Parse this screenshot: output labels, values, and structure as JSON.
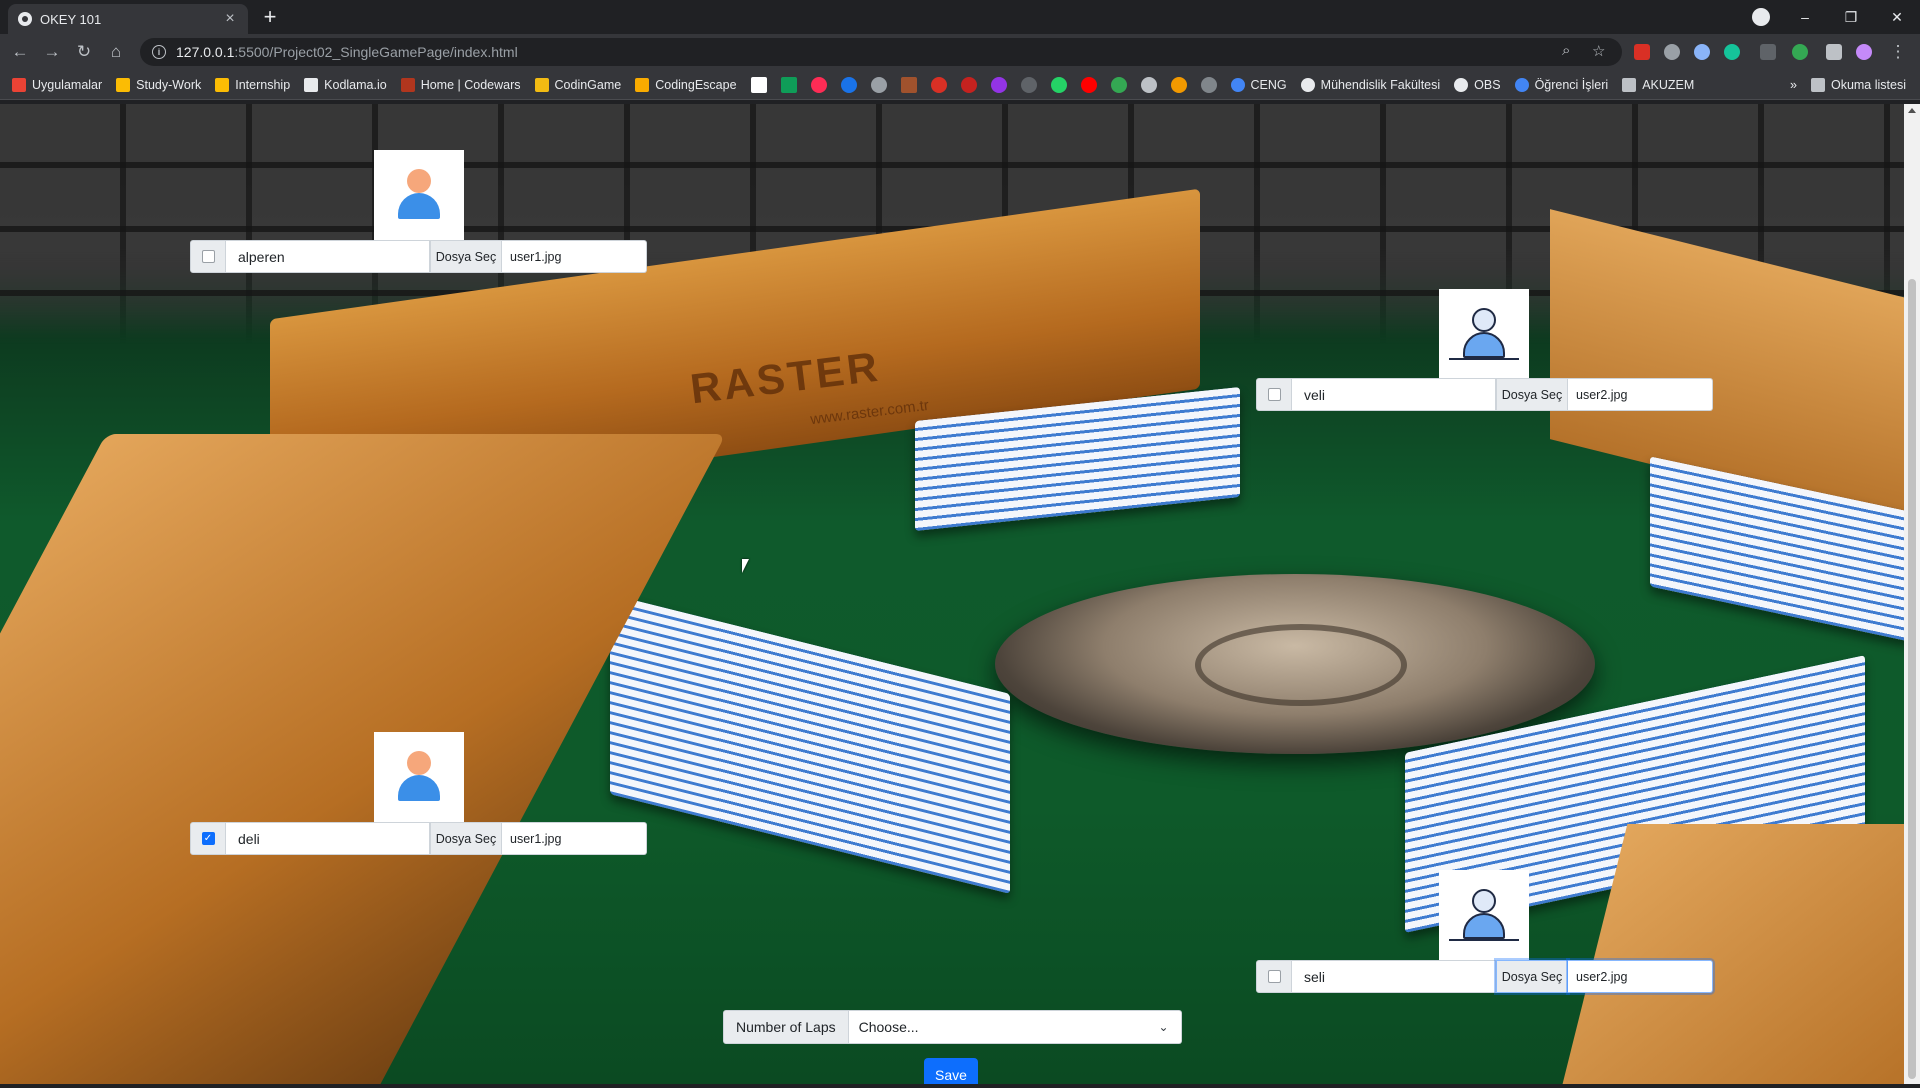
{
  "browser": {
    "tab_title": "OKEY 101",
    "url_host": "127.0.0.1",
    "url_path": ":5500/Project02_SingleGamePage/index.html",
    "bookmarks": [
      "Uygulamalar",
      "Study-Work",
      "Internship",
      "Kodlama.io",
      "Home | Codewars",
      "CodinGame",
      "CodingEscape",
      "CENG",
      "Mühendislik Fakültesi",
      "OBS",
      "Öğrenci İşleri",
      "AKUZEM"
    ],
    "more_bookmarks": "»",
    "reading_list": "Okuma listesi"
  },
  "players": [
    {
      "name": "alperen",
      "checked": false,
      "file_button": "Dosya Seç",
      "file_name": "user1.jpg"
    },
    {
      "name": "veli",
      "checked": false,
      "file_button": "Dosya Seç",
      "file_name": "user2.jpg"
    },
    {
      "name": "deli",
      "checked": true,
      "file_button": "Dosya Seç",
      "file_name": "user1.jpg"
    },
    {
      "name": "seli",
      "checked": false,
      "file_button": "Dosya Seç",
      "file_name": "user2.jpg"
    }
  ],
  "laps": {
    "label": "Number of Laps",
    "selected": "Choose..."
  },
  "save_label": "Save",
  "scene": {
    "brand": "RASTER",
    "brand_url": "www.raster.com.tr"
  },
  "colors": {
    "primary": "#0d6efd",
    "felt": "#0f5a2c"
  }
}
